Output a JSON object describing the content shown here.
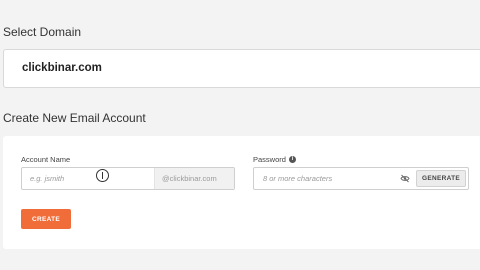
{
  "select_domain": {
    "title": "Select Domain",
    "value": "clickbinar.com"
  },
  "create_account": {
    "title": "Create New Email Account",
    "account_name": {
      "label": "Account Name",
      "placeholder": "e.g. jsmith",
      "value": "",
      "suffix": "@clickbinar.com"
    },
    "password": {
      "label": "Password",
      "info_icon": "info-icon",
      "placeholder": "8 or more characters",
      "value": "",
      "visibility_icon": "eye-slash-icon",
      "generate_label": "GENERATE"
    },
    "create_label": "CREATE"
  },
  "colors": {
    "accent": "#f06d3a",
    "background": "#f3f3f3",
    "card": "#ffffff"
  }
}
